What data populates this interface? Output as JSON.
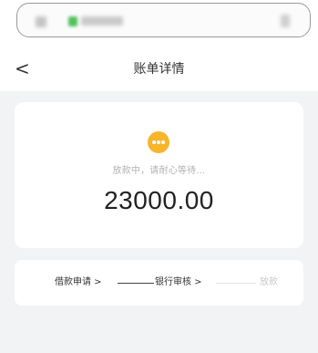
{
  "browser": {
    "url_masked": "",
    "menu": ""
  },
  "nav": {
    "back_label": "<",
    "title": "账单详情"
  },
  "bill": {
    "status_text": "放款中，请耐心等待…",
    "amount": "23000.00"
  },
  "progress": {
    "steps": [
      {
        "label": "借款申请 >",
        "state": "done"
      },
      {
        "label": "银行审核 >",
        "state": "current"
      },
      {
        "label": "放款",
        "state": "pending"
      }
    ]
  },
  "colors": {
    "accent": "#f7b52c",
    "background": "#f2f3f5"
  }
}
